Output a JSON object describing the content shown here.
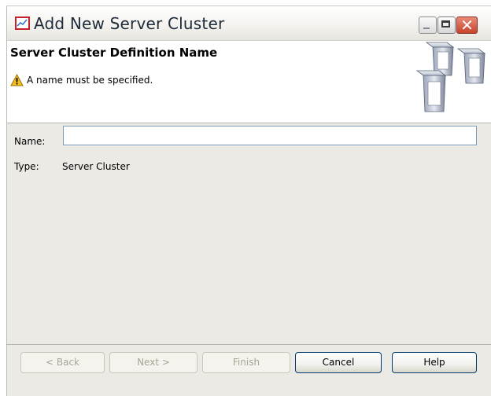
{
  "window": {
    "title": "Add New Server Cluster",
    "app_icon": "chart-window-icon",
    "controls": [
      "minimize",
      "maximize",
      "close"
    ]
  },
  "header": {
    "title": "Server Cluster Definition Name",
    "message": "A name must be specified.",
    "message_icon": "warning-icon",
    "illustration": "server-cluster-icon"
  },
  "form": {
    "name_label": "Name:",
    "name_value": "",
    "type_label": "Type:",
    "type_value": "Server Cluster"
  },
  "footer": {
    "back_label": "< Back",
    "next_label": "Next >",
    "finish_label": "Finish",
    "cancel_label": "Cancel",
    "help_label": "Help"
  },
  "colors": {
    "title_text": "#1e2b3a",
    "close_button": "#c8432b",
    "warning": "#f4c020",
    "dialog_background": "#eceae5"
  }
}
